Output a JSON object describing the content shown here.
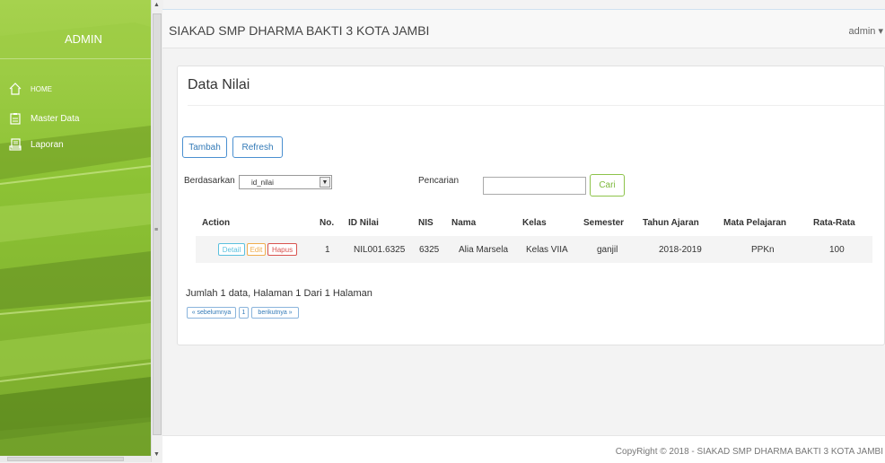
{
  "sidebar": {
    "brand": "ADMIN",
    "items": [
      {
        "label": "HOME",
        "icon": "home-icon"
      },
      {
        "label": "Master Data",
        "icon": "clipboard-icon"
      },
      {
        "label": "Laporan",
        "icon": "report-icon"
      }
    ]
  },
  "topbar": {
    "title": "SIAKAD SMP DHARMA BAKTI 3 KOTA JAMBI",
    "user_menu": "admin ▾"
  },
  "panel": {
    "heading": "Data Nilai",
    "add_label": "Tambah",
    "refresh_label": "Refresh",
    "filter_label": "Berdasarkan",
    "filter_value": "id_nilai",
    "search_label": "Pencarian",
    "search_value": "",
    "search_button": "Cari"
  },
  "table": {
    "columns": [
      "Action",
      "No.",
      "ID Nilai",
      "NIS",
      "Nama",
      "Kelas",
      "Semester",
      "Tahun Ajaran",
      "Mata Pelajaran",
      "Rata-Rata"
    ],
    "rows": [
      {
        "actions": [
          "Detail",
          "Edit",
          "Hapus"
        ],
        "no": "1",
        "id_nilai": "NIL001.6325",
        "nis": "6325",
        "nama": "Alia Marsela",
        "kelas": "Kelas VIIA",
        "semester": "ganjil",
        "tahun_ajaran": "2018-2019",
        "mapel": "PPKn",
        "rata": "100"
      }
    ]
  },
  "pagination": {
    "summary": "Jumlah 1 data, Halaman 1 Dari 1 Halaman",
    "prev": "« sebelumnya",
    "current": "1",
    "next": "berikutnya »"
  },
  "footer": {
    "copyright": "CopyRight © 2018 - SIAKAD SMP DHARMA BAKTI 3 KOTA JAMBI"
  },
  "colors": {
    "sidebar_green": "#8cc234",
    "primary": "#337ab7",
    "success": "#7cb83b",
    "info": "#5bc0de",
    "warning": "#f0ad4e",
    "danger": "#d9534f"
  }
}
